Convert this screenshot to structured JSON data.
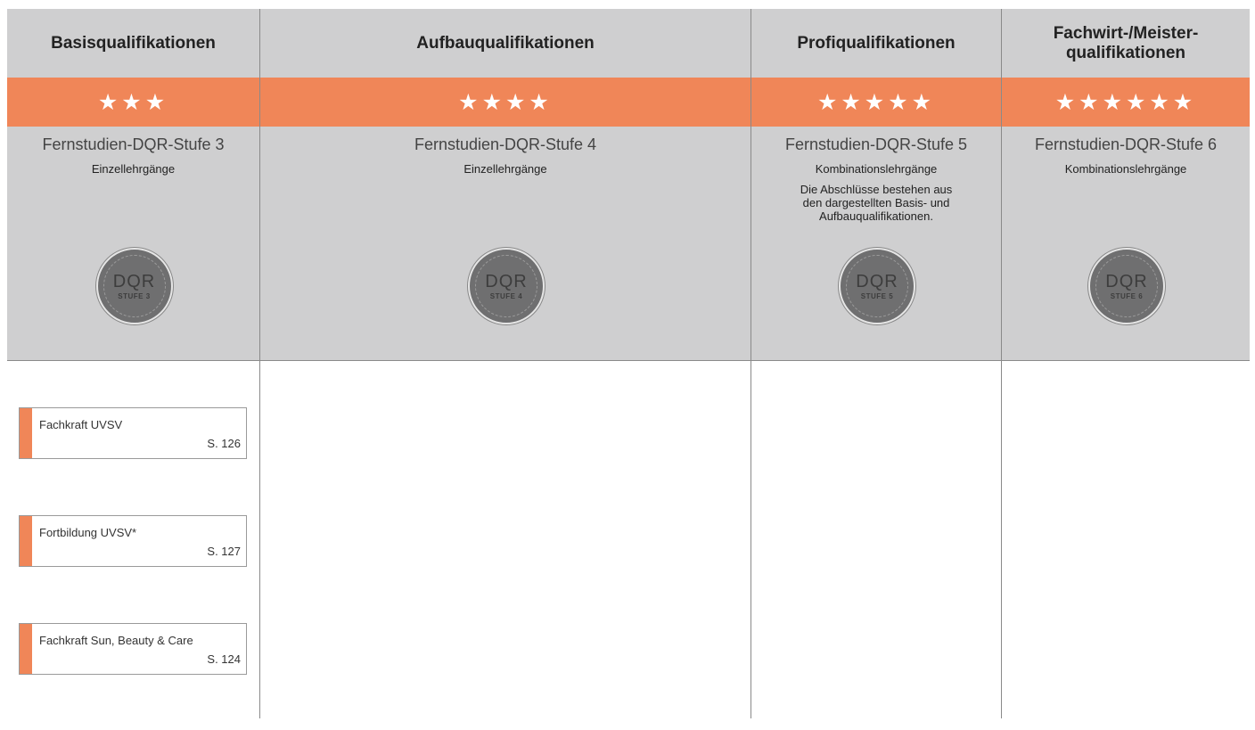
{
  "columns": [
    {
      "header": "Basisqualifikationen",
      "stars": "★★★",
      "level": "Fernstudien-DQR-Stufe 3",
      "type": "Einzellehrgänge",
      "note": "",
      "badge_title": "DQR",
      "badge_sub": "STUFE 3"
    },
    {
      "header": "Aufbauqualifikationen",
      "stars": "★★★★",
      "level": "Fernstudien-DQR-Stufe 4",
      "type": "Einzellehrgänge",
      "note": "",
      "badge_title": "DQR",
      "badge_sub": "STUFE 4"
    },
    {
      "header": "Profiqualifikationen",
      "stars": "★★★★★",
      "level": "Fernstudien-DQR-Stufe 5",
      "type": "Kombinationslehrgänge",
      "note": "Die Abschlüsse bestehen aus den dargestellten Basis- und Aufbauqualifikationen.",
      "badge_title": "DQR",
      "badge_sub": "STUFE 5"
    },
    {
      "header": "Fachwirt-/Meister-qualifikationen",
      "stars": "★★★★★★",
      "level": "Fernstudien-DQR-Stufe 6",
      "type": "Kombinationslehrgänge",
      "note": "",
      "badge_title": "DQR",
      "badge_sub": "STUFE 6"
    }
  ],
  "courses": [
    {
      "title": "Fachkraft UVSV",
      "page": "S. 126"
    },
    {
      "title": "Fortbildung UVSV*",
      "page": "S. 127"
    },
    {
      "title": "Fachkraft Sun, Beauty & Care",
      "page": "S. 124"
    }
  ],
  "colors": {
    "accent": "#f08658",
    "panel": "#cfcfd0",
    "rule": "#8a8a8a"
  }
}
